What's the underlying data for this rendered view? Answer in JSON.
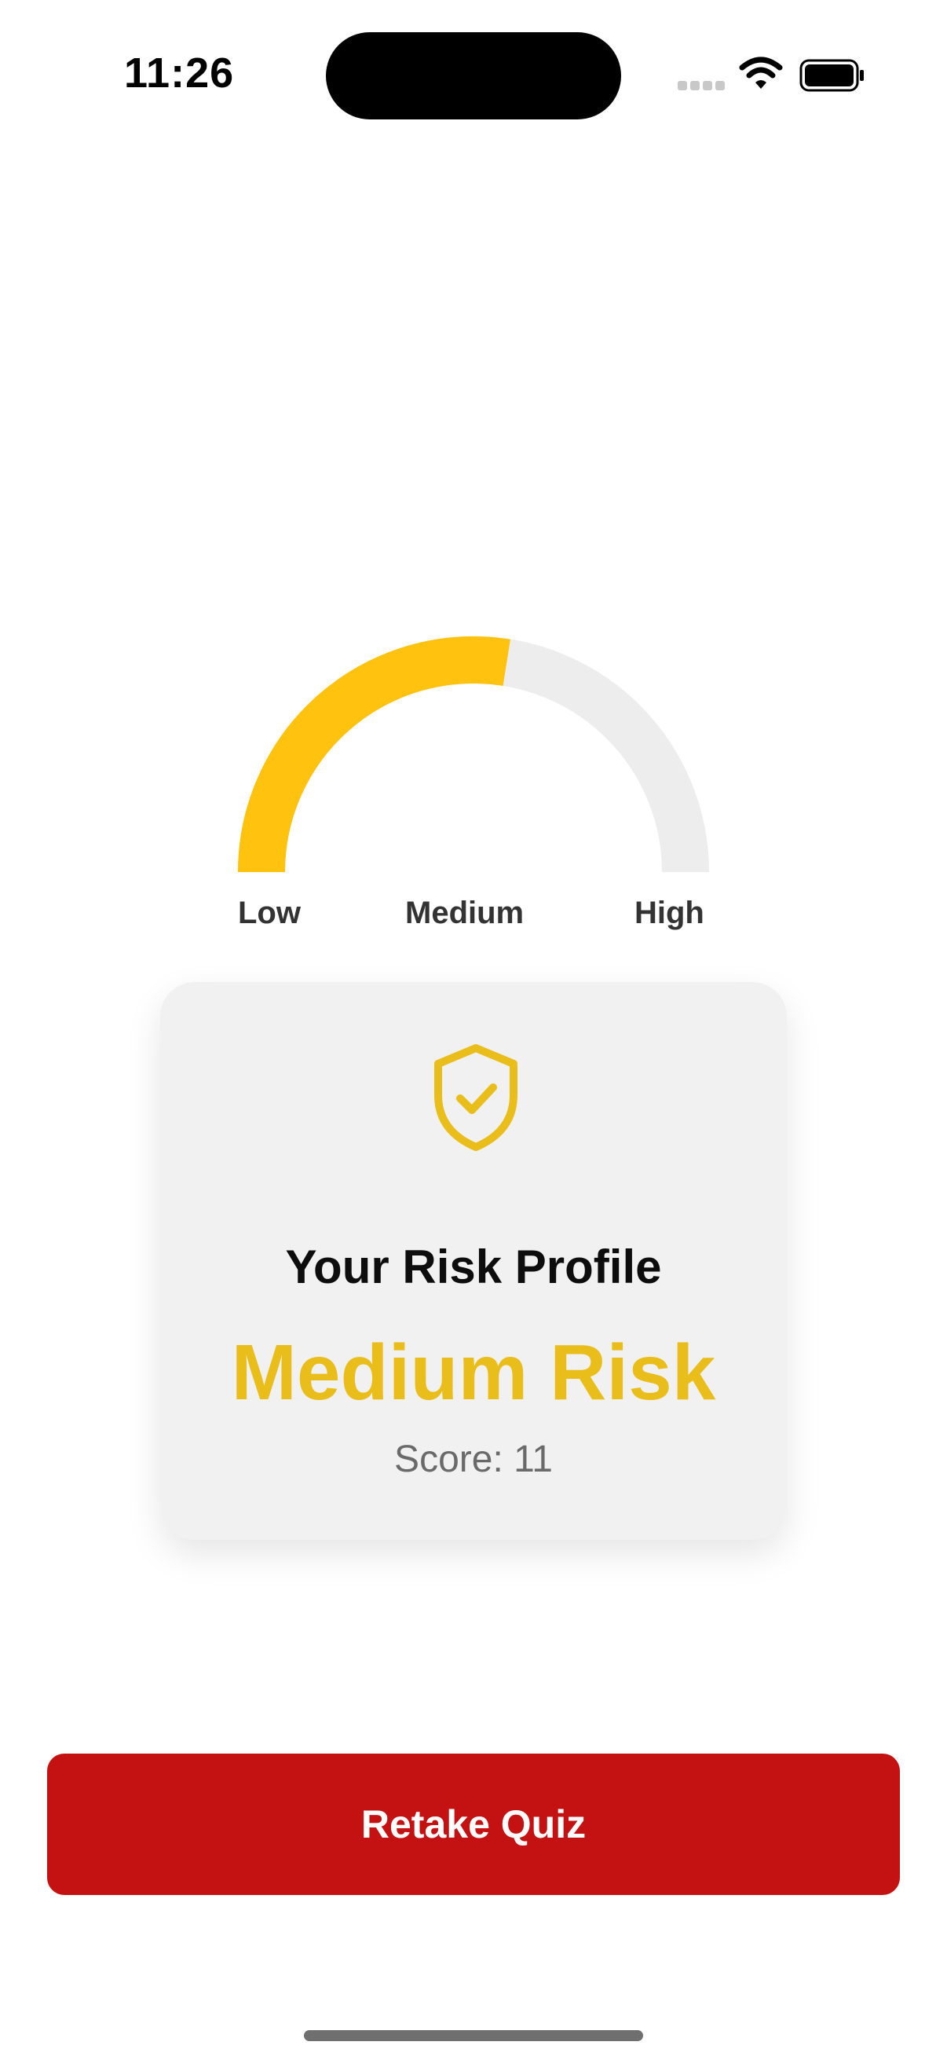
{
  "status_bar": {
    "time": "11:26"
  },
  "gauge": {
    "level_fraction": 0.55,
    "fill_color": "#FFC20E",
    "track_color": "#EDEDED",
    "labels": {
      "low": "Low",
      "medium": "Medium",
      "high": "High"
    }
  },
  "card": {
    "icon": "shield-check-icon",
    "title": "Your Risk Profile",
    "risk_level": "Medium Risk",
    "score_text": "Score: 11",
    "accent_color": "#E9BD1A"
  },
  "actions": {
    "retake_label": "Retake Quiz",
    "button_color": "#C41213"
  }
}
